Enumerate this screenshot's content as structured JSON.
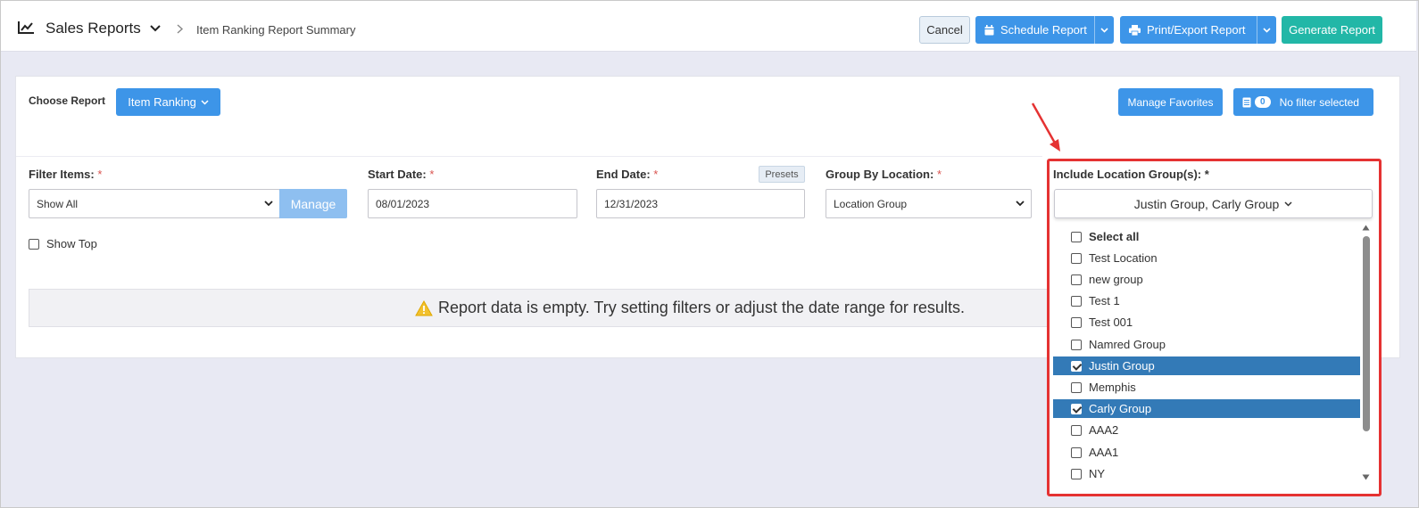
{
  "header": {
    "title": "Sales Reports",
    "breadcrumb": "Item Ranking Report Summary",
    "cancel_label": "Cancel",
    "schedule_label": "Schedule Report",
    "print_label": "Print/Export Report",
    "generate_label": "Generate Report"
  },
  "report": {
    "choose_label": "Choose Report",
    "selected": "Item Ranking",
    "manage_favorites_label": "Manage Favorites",
    "filter_count": "0",
    "filter_status": "No filter selected"
  },
  "filters": {
    "filter_items_label": "Filter Items:",
    "filter_items_value": "Show All",
    "manage_label": "Manage",
    "start_date_label": "Start Date:",
    "start_date_value": "08/01/2023",
    "end_date_label": "End Date:",
    "end_date_value": "12/31/2023",
    "presets_label": "Presets",
    "group_by_label": "Group By Location:",
    "group_by_value": "Location Group",
    "required_mark": "*",
    "show_top_label": "Show Top"
  },
  "empty_message": "Report data is empty. Try setting filters or adjust the date range for results.",
  "location_groups": {
    "label": "Include Location Group(s): *",
    "summary": "Justin Group, Carly Group",
    "items": [
      {
        "label": "Select all",
        "checked": false,
        "bold": true
      },
      {
        "label": "Test Location",
        "checked": false
      },
      {
        "label": "new group",
        "checked": false
      },
      {
        "label": "Test 1",
        "checked": false
      },
      {
        "label": "Test 001",
        "checked": false
      },
      {
        "label": "Namred Group",
        "checked": false
      },
      {
        "label": "Justin Group",
        "checked": true
      },
      {
        "label": "Memphis",
        "checked": false
      },
      {
        "label": "Carly Group",
        "checked": true
      },
      {
        "label": "AAA2",
        "checked": false
      },
      {
        "label": "AAA1",
        "checked": false
      },
      {
        "label": "NY",
        "checked": false
      }
    ]
  },
  "colors": {
    "primary_blue": "#3d95e8",
    "teal": "#22b7a7",
    "highlight_red": "#e53232",
    "selected_row": "#337ab7"
  }
}
